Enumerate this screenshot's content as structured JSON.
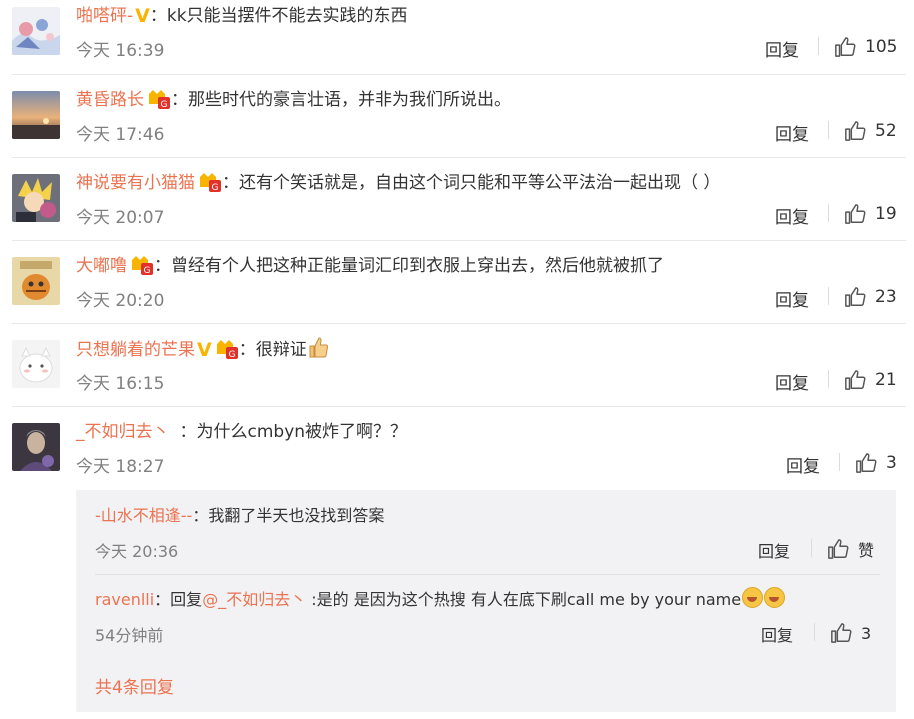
{
  "colors": {
    "name": "#eb7350",
    "text": "#333333",
    "time": "#808080",
    "sub_bg": "#f2f2f5"
  },
  "comments": [
    {
      "user": "啪嗒砰-",
      "badges": [
        "v"
      ],
      "text": "：kk只能当摆件不能去实践的东西",
      "time": "今天 16:39",
      "reply": "回复",
      "likes": "105"
    },
    {
      "user": "黄昏路长",
      "badges": [
        "member"
      ],
      "text": "：那些时代的豪言壮语，并非为我们所说出。",
      "time": "今天 17:46",
      "reply": "回复",
      "likes": "52"
    },
    {
      "user": "神说要有小猫猫",
      "badges": [
        "member"
      ],
      "text": "：还有个笑话就是，自由这个词只能和平等公平法治一起出现（ ）",
      "time": "今天 20:07",
      "reply": "回复",
      "likes": "19"
    },
    {
      "user": "大嘟噜",
      "badges": [
        "member"
      ],
      "text": "：曾经有个人把这种正能量词汇印到衣服上穿出去，然后他就被抓了",
      "time": "今天 20:20",
      "reply": "回复",
      "likes": "23"
    },
    {
      "user": "只想躺着的芒果",
      "badges": [
        "v",
        "member"
      ],
      "text": "：很辩证",
      "emoji": "thumbs-up",
      "time": "今天 16:15",
      "reply": "回复",
      "likes": "21"
    },
    {
      "user": "_不如归去丶",
      "badges": [],
      "text": "：为什么cmbyn被炸了啊？？",
      "time": "今天 18:27",
      "reply": "回复",
      "likes": "3"
    }
  ],
  "sub_replies": [
    {
      "user": "-山水不相逢--",
      "text": "：我翻了半天也没找到答案",
      "time": "今天 20:36",
      "reply": "回复",
      "likes": "赞"
    },
    {
      "user": "ravenlli",
      "prefix": "：回复",
      "mention": "@_不如归去丶",
      "text": " :是的 是因为这个热搜 有人在底下刷call me by your name",
      "emoji": [
        "laughing-emoji",
        "laughing-emoji"
      ],
      "time": "54分钟前",
      "reply": "回复",
      "likes": "3"
    }
  ],
  "more_replies": "共4条回复"
}
